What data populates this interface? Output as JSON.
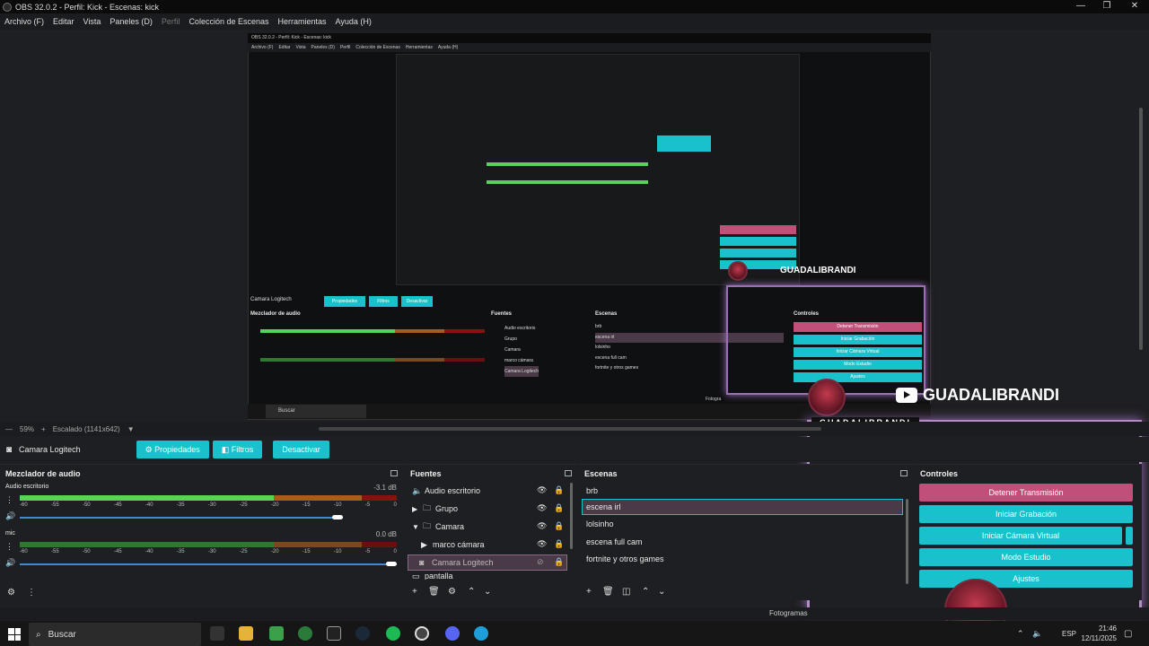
{
  "window": {
    "title": "OBS 32.0.2 - Perfil: Kick - Escenas: kick",
    "controls": [
      "—",
      "❐",
      "✕"
    ]
  },
  "menu": [
    "Archivo (F)",
    "Editar",
    "Vista",
    "Paneles (D)",
    "Perfil",
    "Colección de Escenas",
    "Herramientas",
    "Ayuda (H)"
  ],
  "nested_preview": {
    "title": "OBS 32.0.2 - Perfil: Kick - Escenas: kick",
    "menu": [
      "Archivo (F)",
      "Editar",
      "Vista",
      "Paneles (D)",
      "Perfil",
      "Colección de Escenas",
      "Herramientas",
      "Ayuda (H)"
    ],
    "source_name": "Camara Logitech",
    "buttons": [
      "Propiedades",
      "Filtros",
      "Desactivar"
    ],
    "mixer_title": "Mezclador de audio",
    "sources_title": "Fuentes",
    "scenes_title": "Escenas",
    "controls_title": "Controles",
    "sources": [
      "Audio escritorio",
      "Grupo",
      "Camara",
      "marco cámara",
      "Camara Logitech"
    ],
    "scenes": [
      "brb",
      "escena irl",
      "lolsinho",
      "escena full cam",
      "fortnite y otros games"
    ],
    "controls": [
      "Detener Transmisión",
      "Iniciar Grabación",
      "Iniciar Cámara Virtual",
      "Modo Estudio",
      "Ajustes"
    ],
    "taskbar_search": "Buscar",
    "status_partial": "Fotogra"
  },
  "zoom": {
    "level": "59%",
    "scale": "Escalado (1141x642)"
  },
  "source_toolbar": {
    "source_name": "Camara Logitech",
    "properties_label": "Propiedades",
    "filters_label": "Filtros",
    "deactivate_label": "Desactivar"
  },
  "mixer": {
    "title": "Mezclador de audio",
    "ticks": [
      "-60",
      "-55",
      "-50",
      "-45",
      "-40",
      "-35",
      "-30",
      "-25",
      "-20",
      "-15",
      "-10",
      "-5",
      "0"
    ],
    "tracks": [
      {
        "name": "Audio escritorio",
        "db": "-3.1 dB",
        "level": 0.6,
        "volume": 0.85
      },
      {
        "name": "mic",
        "db": "0.0 dB",
        "level": 0.0,
        "volume": 1.0
      }
    ]
  },
  "sources": {
    "title": "Fuentes",
    "items": [
      {
        "label": "Audio escritorio",
        "icon": "speaker-icon",
        "indent": 0
      },
      {
        "label": "Grupo",
        "icon": "folder-icon",
        "indent": 1,
        "expander": "▶"
      },
      {
        "label": "Camara",
        "icon": "folder-icon",
        "indent": 1,
        "expander": "▼"
      },
      {
        "label": "marco cámara",
        "icon": "play-icon",
        "indent": 2
      },
      {
        "label": "Camara Logitech",
        "icon": "camera-icon",
        "indent": 0,
        "selected": true
      },
      {
        "label": "pantalla",
        "icon": "window-icon",
        "indent": 0
      }
    ]
  },
  "scenes": {
    "title": "Escenas",
    "items": [
      "brb",
      "escena irl",
      "lolsinho",
      "escena full cam",
      "fortnite y otros games"
    ],
    "selected": "escena irl"
  },
  "controls": {
    "title": "Controles",
    "stop_stream": "Detener Transmisión",
    "start_recording": "Iniciar Grabación",
    "start_virtual_cam": "Iniciar Cámara Virtual",
    "studio_mode": "Modo Estudio",
    "settings": "Ajustes"
  },
  "overlay": {
    "channel": "GUADALIBRANDI",
    "label": "GUADALIBRANDI"
  },
  "status": {
    "frames_label": "Fotogramas"
  },
  "taskbar": {
    "search": "Buscar",
    "language": "ESP",
    "time": "21:46",
    "date": "12/11/2025"
  },
  "colors": {
    "accent": "#18c2cc",
    "stop": "#c0507a",
    "overlay_glow": "#b58bc8"
  }
}
